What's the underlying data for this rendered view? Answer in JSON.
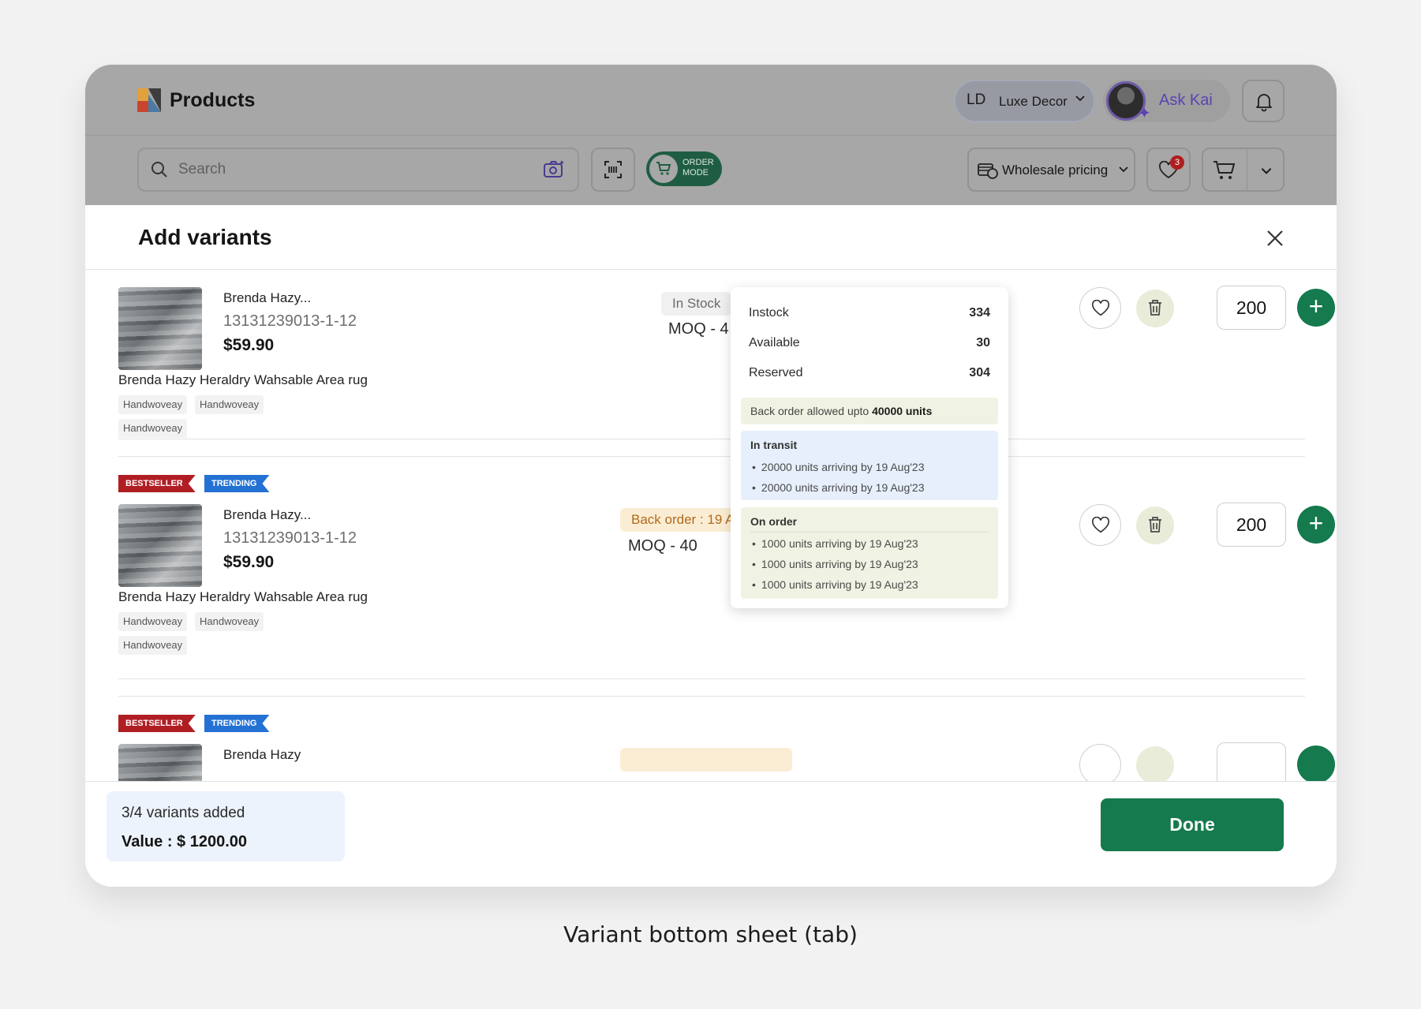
{
  "app": {
    "title": "Products",
    "brand_initials": "LD",
    "brand_name": "Luxe Decor",
    "ai_label": "Ask Kai",
    "accent": "#157a4d"
  },
  "toolbar": {
    "search_placeholder": "Search",
    "order_mode_line1": "ORDER",
    "order_mode_line2": "MODE",
    "pricing_label": "Wholesale pricing",
    "wishlist_count": "3"
  },
  "sheet": {
    "title": "Add variants",
    "items": [
      {
        "name": "Brenda Hazy...",
        "sku": "13131239013-1-12",
        "price": "$59.90",
        "description": "Brenda Hazy Heraldry Wahsable Area rug",
        "tags": [
          "Handwoveay",
          "Handwoveay",
          "Handwoveay"
        ],
        "stock": "In Stock",
        "moq": "MOQ - 4",
        "qty": "200"
      },
      {
        "badges": [
          "BESTSELLER",
          "TRENDING"
        ],
        "name": "Brenda Hazy...",
        "sku": "13131239013-1-12",
        "price": "$59.90",
        "description": "Brenda Hazy Heraldry Wahsable Area rug",
        "tags": [
          "Handwoveay",
          "Handwoveay",
          "Handwoveay"
        ],
        "stock": "Back order : 19 Au",
        "moq": "MOQ - 40",
        "qty": "200"
      },
      {
        "badges": [
          "BESTSELLER",
          "TRENDING"
        ],
        "name": "Brenda Hazy"
      }
    ]
  },
  "popover": {
    "rows": [
      {
        "label": "Instock",
        "value": "334"
      },
      {
        "label": "Available",
        "value": "30"
      },
      {
        "label": "Reserved",
        "value": "304"
      }
    ],
    "backorder_text": "Back order allowed upto ",
    "backorder_value": "40000 units",
    "transit_title": "In transit",
    "transit_items": [
      "20000 units arriving by 19 Aug'23",
      "20000 units arriving by 19 Aug'23"
    ],
    "order_title": "On order",
    "order_items": [
      "1000 units arriving by 19 Aug'23",
      "1000 units arriving by 19 Aug'23",
      "1000 units arriving by 19 Aug'23"
    ]
  },
  "footer": {
    "variants_added": "3/4 variants added",
    "value": "Value : $ 1200.00",
    "done_label": "Done"
  },
  "caption": "Variant bottom sheet (tab)"
}
